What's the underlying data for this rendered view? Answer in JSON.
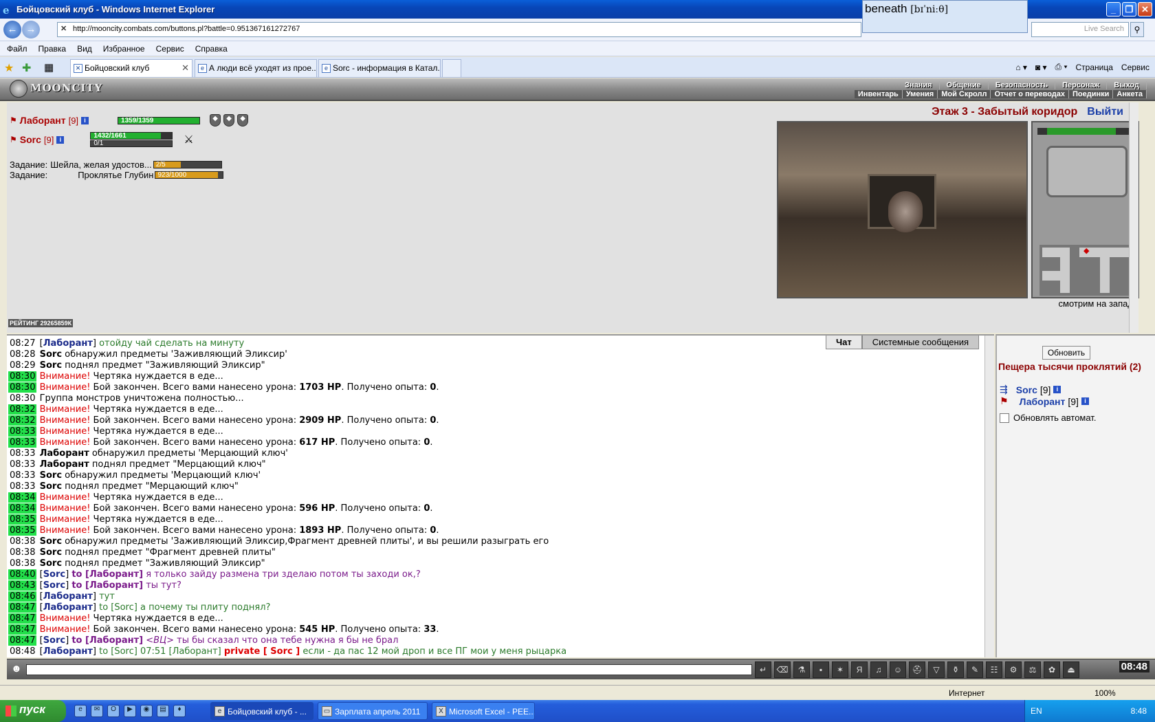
{
  "window": {
    "title": "Бойцовский клуб - Windows Internet Explorer"
  },
  "dictionary_popup": {
    "word": "beneath",
    "phonetic": "[bɪˈniːθ]"
  },
  "address": {
    "url": "http://mooncity.combats.com/buttons.pl?battle=0.951367161272767",
    "search_placeholder": "Live Search"
  },
  "menu": [
    "Файл",
    "Правка",
    "Вид",
    "Избранное",
    "Сервис",
    "Справка"
  ],
  "tabs": [
    {
      "label": "Бойцовский клуб"
    },
    {
      "label": "А люди всё уходят из прое..."
    },
    {
      "label": "Sorc - информация в Катал..."
    }
  ],
  "commandbar": {
    "page": "Страница",
    "tools": "Сервис"
  },
  "game": {
    "logo": "MOONCITY",
    "nav_top": [
      "Знания",
      "Общение",
      "Безопасность",
      "Персонаж",
      "Выход"
    ],
    "nav_bottom": [
      "Инвентарь",
      "Умения",
      "Мой Скролл",
      "Отчет о переводах",
      "Поединки",
      "Анкета"
    ],
    "location": "Этаж 3 - Забытый коридор",
    "exit": "Выйти",
    "facing": "смотрим на запад",
    "rating": "РЕЙТИНГ 29265859К",
    "players": [
      {
        "name": "Лаборант",
        "level": "[9]",
        "hp_text": "1359/1359",
        "hp_frac": 1.0
      },
      {
        "name": "Sorc",
        "level": "[9]",
        "hp_text": "1432/1661",
        "hp_frac": 0.862,
        "mp_text": "0/1",
        "mp_frac": 0
      }
    ],
    "quests": [
      {
        "label": "Задание:",
        "name": "Шейла, желая удостов...",
        "progress": "2/5",
        "frac": 0.4
      },
      {
        "label": "Задание:",
        "name": "Проклятье Глубин",
        "progress": "923/1000",
        "frac": 0.923
      }
    ]
  },
  "chat": {
    "tabs": [
      "Чат",
      "Системные сообщения"
    ],
    "lines": [
      {
        "t": "08:27",
        "g": false,
        "html": "[<span class='nm'>Лаборант</span>] <span class='msg-green'>отойду чай сделать на минуту</span>"
      },
      {
        "t": "08:28",
        "g": false,
        "html": "<b>Sorc</b> обнаружил предметы 'Заживляющий Эликсир'"
      },
      {
        "t": "08:29",
        "g": false,
        "html": "<b>Sorc</b> поднял предмет \"Заживляющий Эликсир\""
      },
      {
        "t": "08:30",
        "g": true,
        "html": "<span class='w'>Внимание!</span> Чертяка нуждается в еде..."
      },
      {
        "t": "08:30",
        "g": true,
        "html": "<span class='w'>Внимание!</span> Бой закончен. Всего вами нанесено урона: <b>1703 HP</b>. Получено опыта: <b>0</b>."
      },
      {
        "t": "08:30",
        "g": false,
        "html": "Группа монстров уничтожена полностью..."
      },
      {
        "t": "08:32",
        "g": true,
        "html": "<span class='w'>Внимание!</span> Чертяка нуждается в еде..."
      },
      {
        "t": "08:32",
        "g": true,
        "html": "<span class='w'>Внимание!</span> Бой закончен. Всего вами нанесено урона: <b>2909 HP</b>. Получено опыта: <b>0</b>."
      },
      {
        "t": "08:33",
        "g": true,
        "html": "<span class='w'>Внимание!</span> Чертяка нуждается в еде..."
      },
      {
        "t": "08:33",
        "g": true,
        "html": "<span class='w'>Внимание!</span> Бой закончен. Всего вами нанесено урона: <b>617 HP</b>. Получено опыта: <b>0</b>."
      },
      {
        "t": "08:33",
        "g": false,
        "html": "<b>Лаборант</b> обнаружил предметы 'Мерцающий ключ'"
      },
      {
        "t": "08:33",
        "g": false,
        "html": "<b>Лаборант</b> поднял предмет \"Мерцающий ключ\""
      },
      {
        "t": "08:33",
        "g": false,
        "html": "<b>Sorc</b> обнаружил предметы 'Мерцающий ключ'"
      },
      {
        "t": "08:33",
        "g": false,
        "html": "<b>Sorc</b> поднял предмет \"Мерцающий ключ\""
      },
      {
        "t": "08:34",
        "g": true,
        "html": "<span class='w'>Внимание!</span> Чертяка нуждается в еде..."
      },
      {
        "t": "08:34",
        "g": true,
        "html": "<span class='w'>Внимание!</span> Бой закончен. Всего вами нанесено урона: <b>596 HP</b>. Получено опыта: <b>0</b>."
      },
      {
        "t": "08:35",
        "g": true,
        "html": "<span class='w'>Внимание!</span> Чертяка нуждается в еде..."
      },
      {
        "t": "08:35",
        "g": true,
        "html": "<span class='w'>Внимание!</span> Бой закончен. Всего вами нанесено урона: <b>1893 HP</b>. Получено опыта: <b>0</b>."
      },
      {
        "t": "08:38",
        "g": false,
        "html": "<b>Sorc</b> обнаружил предметы 'Заживляющий Эликсир,Фрагмент древней плиты', и вы решили разыграть его"
      },
      {
        "t": "08:38",
        "g": false,
        "html": "<b>Sorc</b> поднял предмет \"Фрагмент древней плиты\""
      },
      {
        "t": "08:38",
        "g": false,
        "html": "<b>Sorc</b> поднял предмет \"Заживляющий Эликсир\""
      },
      {
        "t": "08:40",
        "g": true,
        "html": "[<span class='nm'>Sorc</span>] <span class='to'>to [Лаборант]</span> <span class='msg-purple'>я только зайду размена три зделаю потом ты заходи ок,?</span>"
      },
      {
        "t": "08:43",
        "g": true,
        "html": "[<span class='nm'>Sorc</span>] <span class='to'>to [Лаборант]</span> <span class='msg-purple'>ты тут?</span>"
      },
      {
        "t": "08:46",
        "g": true,
        "html": "[<span class='nm'>Лаборант</span>] <span class='msg-green'>тут</span>"
      },
      {
        "t": "08:47",
        "g": true,
        "html": "[<span class='nm'>Лаборант</span>] <span class='msg-green'>to [Sorc] а почему ты плиту поднял?</span>"
      },
      {
        "t": "08:47",
        "g": true,
        "html": "<span class='w'>Внимание!</span> Чертяка нуждается в еде..."
      },
      {
        "t": "08:47",
        "g": true,
        "html": "<span class='w'>Внимание!</span> Бой закончен. Всего вами нанесено урона: <b>545 HP</b>. Получено опыта: <b>33</b>."
      },
      {
        "t": "08:47",
        "g": true,
        "html": "[<span class='nm'>Sorc</span>] <span class='to'>to [Лаборант]</span> <span class='msg-purple'><i>&lt;ВЦ&gt;</i> ты бы сказал что она тебе нужна я бы не брал</span>"
      },
      {
        "t": "08:48",
        "g": false,
        "html": "[<span class='nm'>Лаборант</span>] <span class='msg-green'>to [Sorc] 07:51 [Лаборант]</span> <span class='w b'>private [ Sorc ]</span> <span class='msg-green'>если - да пас 12 мой дроп и все ПГ мои у меня рыцарка</span>"
      }
    ]
  },
  "side": {
    "refresh": "Обновить",
    "cave": "Пещера тысячи проклятий (2)",
    "members": [
      {
        "name": "Sorc",
        "level": "[9]"
      },
      {
        "name": "Лаборант",
        "level": "[9]"
      }
    ],
    "auto_refresh": "Обновлять автомат."
  },
  "toolbar": {
    "clock": "08:48"
  },
  "status": {
    "zone": "Интернет",
    "zoom": "100%"
  },
  "taskbar": {
    "start": "пуск",
    "buttons": [
      "Бойцовский клуб - ...",
      "Зарплата апрель 2011",
      "Microsoft Excel - РЕЕ..."
    ],
    "lang": "EN",
    "time": "8:48"
  }
}
